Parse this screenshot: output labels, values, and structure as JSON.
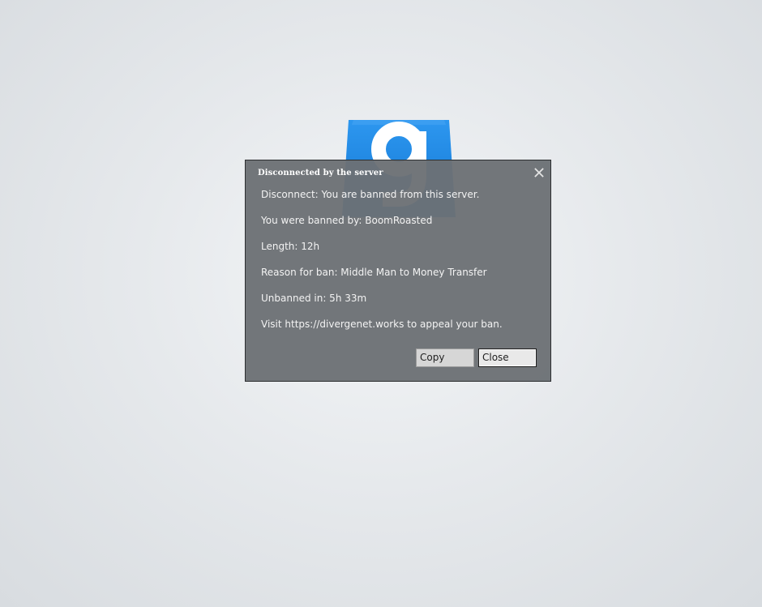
{
  "dialog": {
    "title": "Disconnected by the server",
    "lines": [
      "Disconnect: You are banned from this server.",
      "You were banned by: BoomRoasted",
      "Length: 12h",
      "Reason for ban: Middle Man to Money Transfer",
      "Unbanned in: 5h 33m",
      "Visit https://divergenet.works to appeal your ban."
    ],
    "buttons": {
      "copy_label": "Copy",
      "close_label": "Close"
    }
  },
  "icons": {
    "logo": "gmod-logo-icon",
    "close": "close-icon"
  },
  "colors": {
    "logo_blue": "#1e88e5",
    "dialog_bg": "#6c7075",
    "text": "#f3f3f3"
  }
}
